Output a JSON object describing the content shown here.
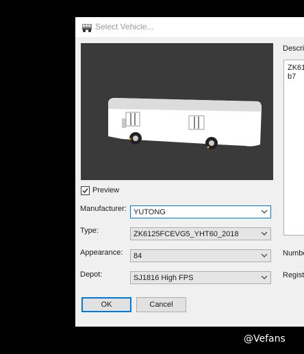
{
  "window": {
    "title": "Select Vehicle..."
  },
  "preview": {
    "checkbox_label": "Preview",
    "checked": true
  },
  "fields": {
    "manufacturer": {
      "label": "Manufacturer:",
      "value": "YUTONG"
    },
    "type": {
      "label": "Type:",
      "value": "ZK6125FCEVG5_YHT60_2018"
    },
    "appearance": {
      "label": "Appearance:",
      "value": "84"
    },
    "depot": {
      "label": "Depot:",
      "value": "SJ1816 High FPS"
    }
  },
  "buttons": {
    "ok": "OK",
    "cancel": "Cancel"
  },
  "description": {
    "label": "Descrip",
    "line1": "ZK61",
    "line2": "b7"
  },
  "side_labels": {
    "number": "Numbe",
    "registration": "Regist"
  },
  "watermark": "@Vefans",
  "colors": {
    "accent": "#0078d7",
    "preview_bg": "#3a3a3a",
    "dialog_bg": "#f0f0f0"
  }
}
